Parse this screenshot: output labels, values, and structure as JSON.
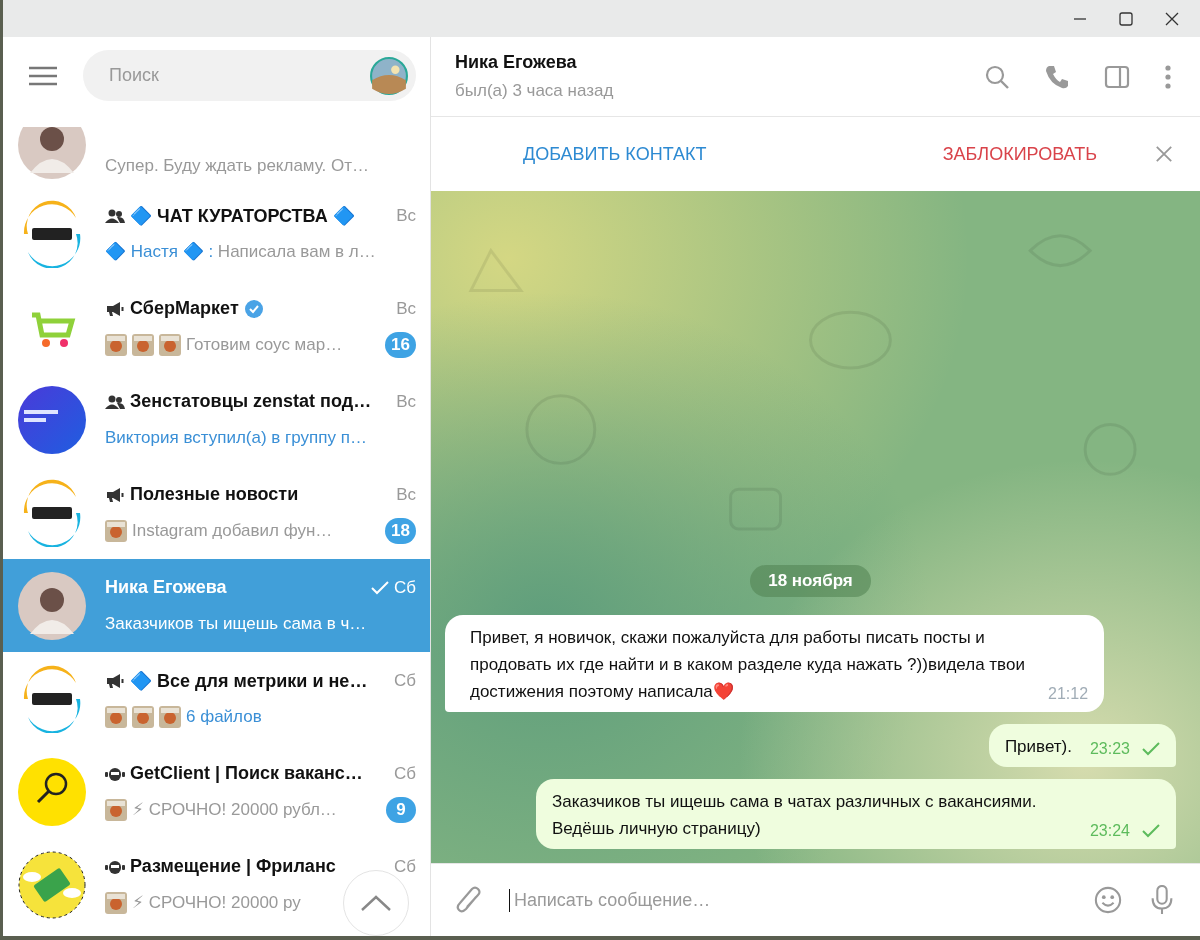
{
  "search": {
    "placeholder": "Поиск"
  },
  "chats": [
    {
      "kind": "partial",
      "avatar": {
        "kind": "person"
      },
      "selected": false,
      "preview": "Супер. Буду ждать рекламу. От…"
    },
    {
      "kind": "group",
      "avatar": {
        "kind": "ring"
      },
      "selected": false,
      "title": "🔷 ЧАТ КУРАТОРСТВА 🔷",
      "time": "Вс",
      "preview_sender": "🔷 Настя 🔷 :",
      "preview": " Написала вам в л…"
    },
    {
      "kind": "channel",
      "avatar": {
        "kind": "cart"
      },
      "selected": false,
      "title": "СберМаркет",
      "verified": true,
      "time": "Вс",
      "preview": "Готовим соус мар…",
      "badge": "16"
    },
    {
      "kind": "group",
      "avatar": {
        "kind": "gradient"
      },
      "selected": false,
      "title": "Зенстатовцы zenstat под…",
      "time": "Вс",
      "preview_sender": "Виктория вступил(а) в группу п…"
    },
    {
      "kind": "channel",
      "avatar": {
        "kind": "ring"
      },
      "selected": false,
      "title": "Полезные новости",
      "time": "Вс",
      "preview": "Instagram добавил фун…",
      "badge": "18"
    },
    {
      "kind": "person",
      "avatar": {
        "kind": "person"
      },
      "selected": true,
      "title": "Ника Егожева",
      "sent": true,
      "time": "Сб",
      "preview": "Заказчиков ты ищешь сама в ч…"
    },
    {
      "kind": "channel",
      "avatar": {
        "kind": "ring"
      },
      "selected": false,
      "title": "🔷 Все для метрики и не…",
      "time": "Сб",
      "preview_sender": "6 файлов"
    },
    {
      "kind": "bot",
      "avatar": {
        "kind": "magnifier"
      },
      "selected": false,
      "title": "GetClient | Поиск ваканс…",
      "time": "Сб",
      "preview": "⚡ СРОЧНО! 20000 рубл…",
      "badge": "9"
    },
    {
      "kind": "bot",
      "avatar": {
        "kind": "money"
      },
      "selected": false,
      "title": "Размещение | Фриланс",
      "time": "Сб",
      "preview": "⚡ СРОЧНО! 20000 ру"
    }
  ],
  "chat": {
    "name": "Ника Егожева",
    "last_seen": "был(а) 3 часа назад"
  },
  "action_bar": {
    "add_contact": "ДОБАВИТЬ КОНТАКТ",
    "block": "ЗАБЛОКИРОВАТЬ"
  },
  "date": "18 ноября",
  "messages": [
    {
      "kind": "incoming",
      "text": "Привет, я новичок, скажи пожалуйста для работы писать посты и продовать их где найти и в каком разделе куда нажать ?))видела твои достижения поэтому написала❤️",
      "time": "21:12",
      "sent": false
    },
    {
      "kind": "outgoing",
      "text": "Привет).",
      "time": "23:23",
      "sent": true
    },
    {
      "kind": "outgoing",
      "text": "Заказчиков ты ищешь сама в чатах различных с вакансиями. Ведёшь личную страницу)",
      "time": "23:24",
      "sent": true
    }
  ],
  "composer": {
    "placeholder": "Написать сообщение…"
  }
}
